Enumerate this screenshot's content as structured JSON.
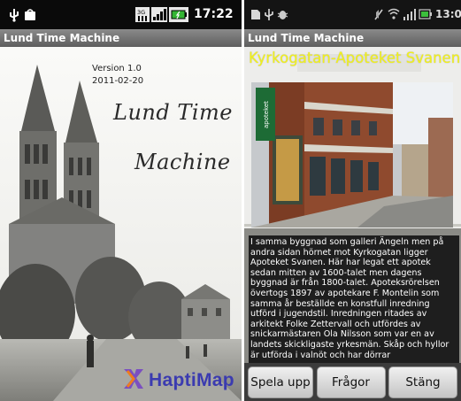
{
  "left_screen": {
    "status_bar": {
      "time": "17:22"
    },
    "title_bar": {
      "title": "Lund Time Machine"
    },
    "splash": {
      "version": "Version 1.0",
      "date": "2011-02-20",
      "script_title_line1": "Lund Time",
      "script_title_line2": "Machine",
      "logo_text": "HaptiMap"
    }
  },
  "right_screen": {
    "status_bar": {
      "time": "13:00"
    },
    "title_bar": {
      "title": "Lund Time Machine"
    },
    "place_title": "Kyrkogatan-Apoteket Svanen",
    "description": "I samma byggnad som galleri Ängeln men på andra sidan hörnet mot Kyrkogatan ligger Apoteket  Svanen. Här har legat ett apotek sedan mitten av 1600-talet men dagens byggnad är från 1800-talet. Apoteksrörelsen övertogs 1897 av apotekare F. Montelin som samma år beställde en konstfull inredning utförd i jugendstil. Inredningen ritades av arkitekt Folke Zettervall och utfördes av snickarmästaren Ola Nilsson som var en av landets skickligaste yrkesmän. Skåp och hyllor är utförda i valnöt och har dörrar",
    "buttons": {
      "play": "Spela upp",
      "questions": "Frågor",
      "close": "Stäng"
    },
    "shop_sign": "apoteket"
  },
  "colors": {
    "status_bar": "#0a0a0a",
    "title_text": "#f2f21a",
    "logo_blue": "#3b3bb0",
    "button_bar": "#3c3c3c"
  }
}
